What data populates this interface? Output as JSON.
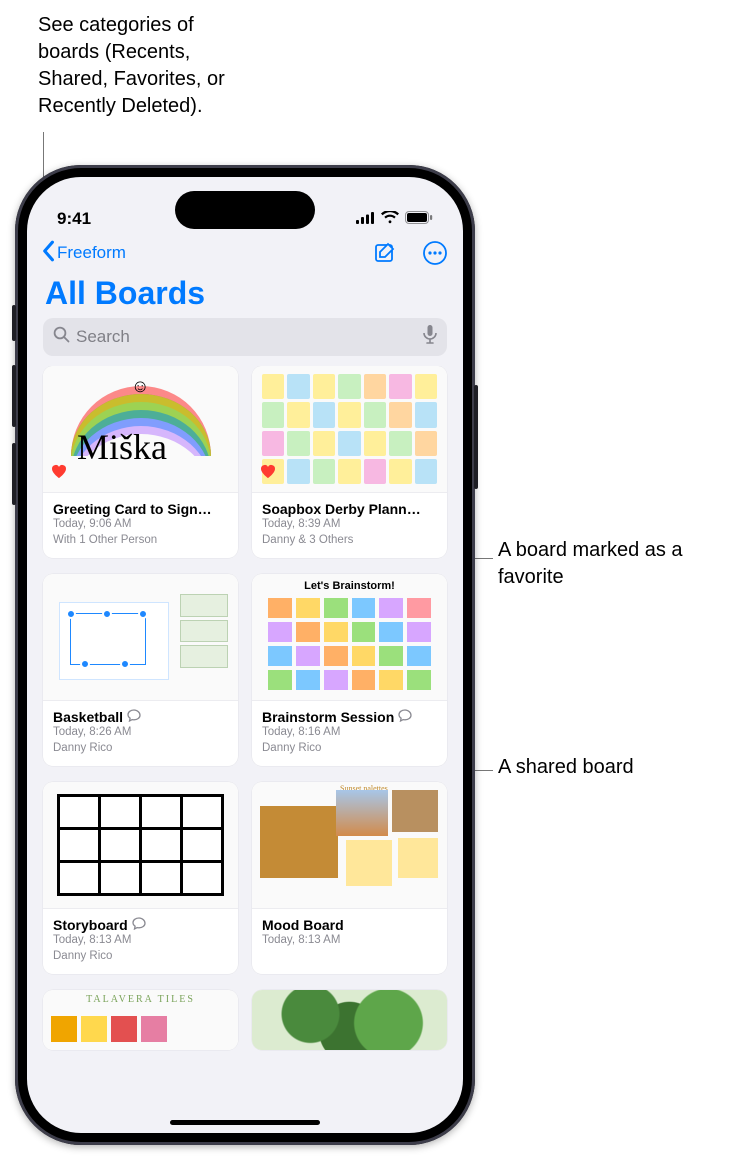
{
  "callouts": {
    "top": "See categories of boards (Recents, Shared, Favorites, or Recently Deleted).",
    "favorite": "A board marked as a favorite",
    "shared": "A shared board"
  },
  "status": {
    "time": "9:41"
  },
  "nav": {
    "back_label": "Freeform"
  },
  "page": {
    "title": "All Boards"
  },
  "search": {
    "placeholder": "Search"
  },
  "boards": [
    {
      "title": "Greeting Card to Sign…",
      "time": "Today, 9:06 AM",
      "shared_with": "With 1 Other Person",
      "favorite": true,
      "shared_icon": false
    },
    {
      "title": "Soapbox Derby Plann…",
      "time": "Today, 8:39 AM",
      "shared_with": "Danny & 3 Others",
      "favorite": true,
      "shared_icon": false
    },
    {
      "title": "Basketball",
      "time": "Today, 8:26 AM",
      "shared_with": "Danny Rico",
      "favorite": false,
      "shared_icon": true
    },
    {
      "title": "Brainstorm Session",
      "time": "Today, 8:16 AM",
      "shared_with": "Danny Rico",
      "favorite": false,
      "shared_icon": true,
      "thumb_title": "Let's Brainstorm!"
    },
    {
      "title": "Storyboard",
      "time": "Today, 8:13 AM",
      "shared_with": "Danny Rico",
      "favorite": false,
      "shared_icon": true
    },
    {
      "title": "Mood Board",
      "time": "Today, 8:13 AM",
      "shared_with": "",
      "favorite": false,
      "shared_icon": false,
      "thumb_tag": "Sunset palettes"
    },
    {
      "title_hidden": "TALAVERA TILES"
    }
  ]
}
